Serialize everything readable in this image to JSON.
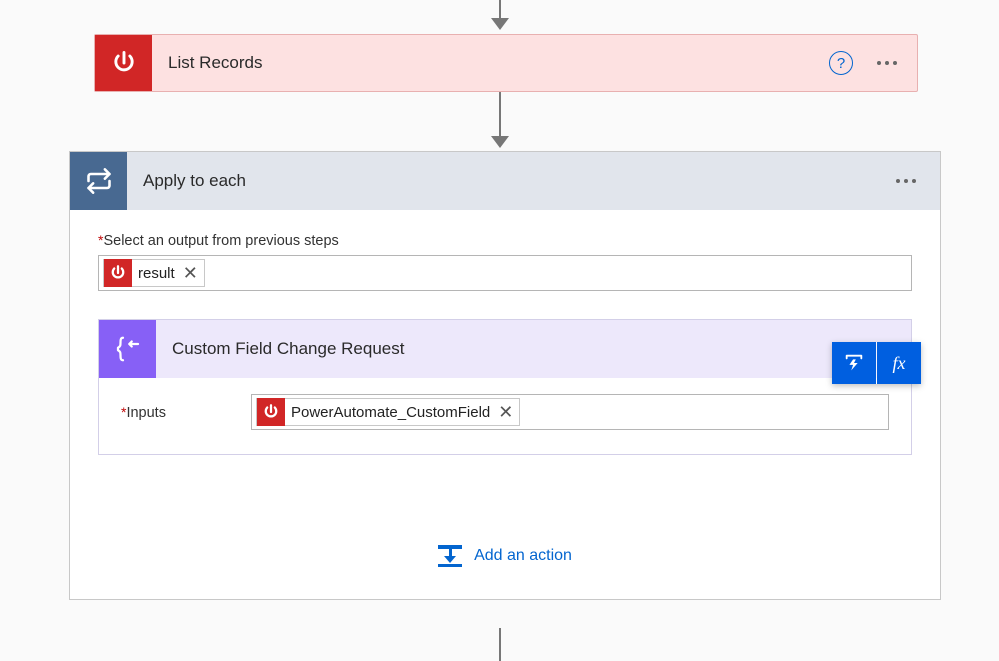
{
  "list_records": {
    "title": "List Records",
    "help_glyph": "?"
  },
  "apply_to_each": {
    "title": "Apply to each",
    "select_output_label": "Select an output from previous steps",
    "token": {
      "text": "result"
    },
    "custom_action": {
      "title": "Custom Field Change Request",
      "inputs_label": "Inputs",
      "token": {
        "text": "PowerAutomate_CustomField"
      }
    },
    "floating_toolbar": {
      "fx_label": "fx"
    },
    "add_action_label": "Add an action"
  }
}
